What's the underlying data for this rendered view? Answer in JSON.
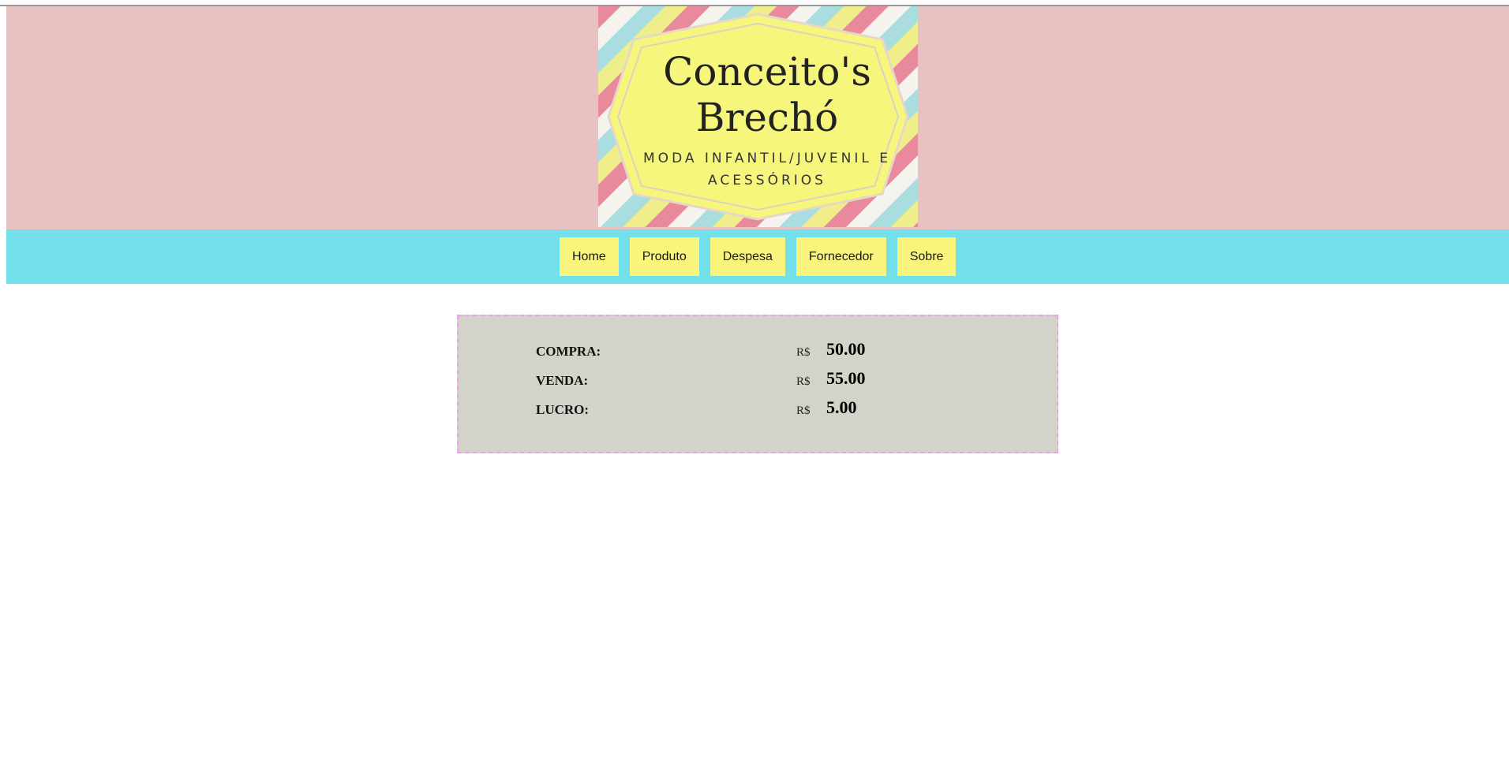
{
  "logo": {
    "title_line1": "Conceito's",
    "title_line2": "Brechó",
    "subtitle_line1": "MODA INFANTIL/JUVENIL E",
    "subtitle_line2": "ACESSÓRIOS",
    "colors": {
      "badge": "#f6f67c",
      "stripe_pink": "#e8899c",
      "stripe_blue": "#a9dde0",
      "stripe_yellow": "#f0ee8a",
      "stripe_light": "#f5f3ee",
      "text": "#222222"
    }
  },
  "nav": {
    "items": [
      {
        "label": "Home"
      },
      {
        "label": "Produto"
      },
      {
        "label": "Despesa"
      },
      {
        "label": "Fornecedor"
      },
      {
        "label": "Sobre"
      }
    ]
  },
  "summary": {
    "rows": [
      {
        "label": "COMPRA:",
        "currency": "R$",
        "value": "50.00"
      },
      {
        "label": "VENDA:",
        "currency": "R$",
        "value": "55.00"
      },
      {
        "label": "LUCRO:",
        "currency": "R$",
        "value": "5.00"
      }
    ]
  },
  "colors": {
    "header_bg": "#e8c2c3",
    "nav_bg": "#73dfeb",
    "nav_button": "#f8f47c",
    "panel_bg": "#d4d3ca",
    "panel_border": "#e5a6e8"
  }
}
